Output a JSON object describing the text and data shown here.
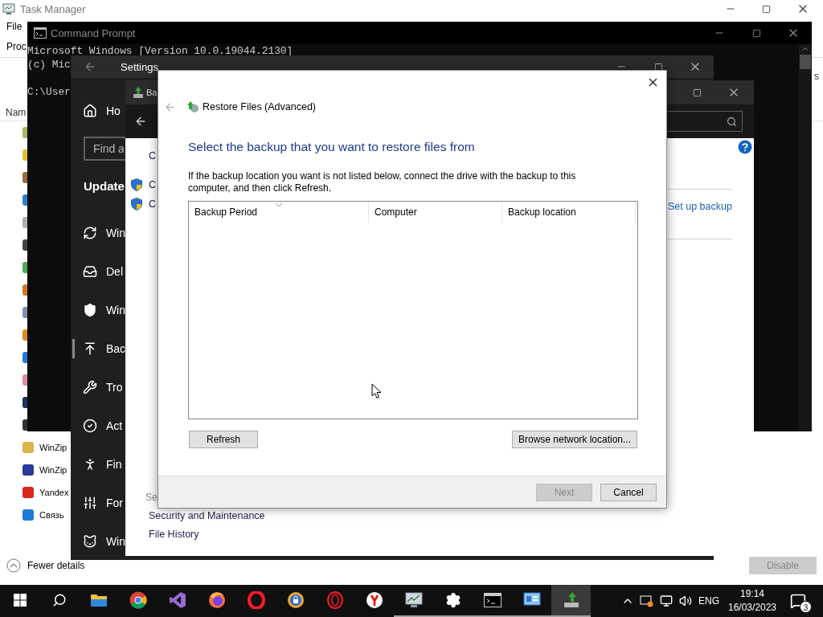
{
  "task_manager": {
    "title": "Task Manager",
    "menu": [
      "File"
    ],
    "tab": "Proc",
    "column_1": "Nam",
    "column_2": "s",
    "apps": [
      {
        "color": "#a9b85a"
      },
      {
        "color": "#e7c12c"
      },
      {
        "color": "#9a6d3a"
      },
      {
        "color": "#2f7fd0"
      },
      {
        "color": "#b0b0b0"
      },
      {
        "color": "#444444"
      },
      {
        "color": "#4caf50"
      },
      {
        "color": "#d07a2a"
      },
      {
        "color": "#8090b0"
      },
      {
        "color": "#e08a1e"
      },
      {
        "color": "#1e7ad8"
      },
      {
        "color": "#e08aa0"
      },
      {
        "color": "#203060"
      },
      {
        "color": "#333333"
      },
      {
        "name": "WinZip",
        "color": "#d9b54a"
      },
      {
        "name": "WinZip",
        "color": "#2a3a9a"
      },
      {
        "name": "Yandex",
        "color": "#d9251b"
      },
      {
        "name": "Связь",
        "color": "#1e7ad8"
      }
    ],
    "footer_toggle": "Fewer details",
    "footer_button": {
      "label": "Disable",
      "disabled": true
    }
  },
  "command_prompt": {
    "title": "Command Prompt",
    "output": [
      [
        "Microsoft Windows [Version 10.0.19044.2130]",
        "(c) Mic"
      ],
      [
        "C:\\User"
      ]
    ]
  },
  "settings": {
    "title": "Settings",
    "home": "Ho",
    "search": {
      "placeholder": "Find a"
    },
    "section": "Update",
    "nav": [
      {
        "kind": "update",
        "label": "Win",
        "selected": false
      },
      {
        "kind": "delivery",
        "label": "Del",
        "selected": false
      },
      {
        "kind": "security",
        "label": "Win",
        "selected": false
      },
      {
        "kind": "backup",
        "label": "Bac",
        "selected": true
      },
      {
        "kind": "troubleshoot",
        "label": "Tro",
        "selected": false
      },
      {
        "kind": "activation",
        "label": "Act",
        "selected": false
      },
      {
        "kind": "find",
        "label": "Fin",
        "selected": false
      },
      {
        "kind": "developers",
        "label": "For",
        "selected": false
      },
      {
        "kind": "insider",
        "label": "Win",
        "selected": false
      }
    ]
  },
  "backup_window": {
    "title": "Ba",
    "sidebar": [
      {
        "kind": "plain",
        "label": "C"
      },
      {
        "kind": "shield",
        "label": "C"
      },
      {
        "kind": "shield",
        "label": "C"
      }
    ],
    "link": "Set up backup",
    "see_also": [
      "Se",
      "Security and Maintenance",
      "File History"
    ]
  },
  "dialog": {
    "title": "Restore Files (Advanced)",
    "heading": "Select the backup that you want to restore files from",
    "instructions": "If the backup location you want is not listed below, connect the drive with the backup to this computer, and then click Refresh.",
    "table": {
      "columns": [
        {
          "label": "Backup Period",
          "sorted": true
        },
        {
          "label": "Computer",
          "sorted": false
        },
        {
          "label": "Backup location",
          "sorted": false
        }
      ]
    },
    "actions": [
      {
        "label": "Refresh"
      },
      {
        "label": "Browse network location..."
      }
    ],
    "footer_buttons": [
      {
        "label": "Next",
        "disabled": true
      },
      {
        "label": "Cancel",
        "disabled": false
      }
    ]
  },
  "taskbar": {
    "apps": [
      {
        "kind": "start",
        "running": false,
        "selected": false
      },
      {
        "kind": "search",
        "running": false,
        "selected": false
      },
      {
        "kind": "folder",
        "running": false,
        "selected": false
      },
      {
        "kind": "chrome",
        "running": false,
        "selected": false
      },
      {
        "kind": "studio",
        "running": false,
        "selected": false
      },
      {
        "kind": "firefox",
        "running": false,
        "selected": false
      },
      {
        "kind": "opera",
        "running": false,
        "selected": false
      },
      {
        "kind": "lockbrowser",
        "running": false,
        "selected": false
      },
      {
        "kind": "operagx",
        "running": false,
        "selected": false
      },
      {
        "kind": "yandex",
        "running": false,
        "selected": false
      },
      {
        "kind": "taskmgr",
        "running": true,
        "selected": false
      },
      {
        "kind": "gear",
        "running": true,
        "selected": false
      },
      {
        "kind": "terminal",
        "running": true,
        "selected": false
      },
      {
        "kind": "panel",
        "running": true,
        "selected": false
      },
      {
        "kind": "backup",
        "running": true,
        "selected": true
      }
    ],
    "language": "ENG",
    "time": "19:14",
    "date": "16/03/2023",
    "notifications": "3"
  }
}
